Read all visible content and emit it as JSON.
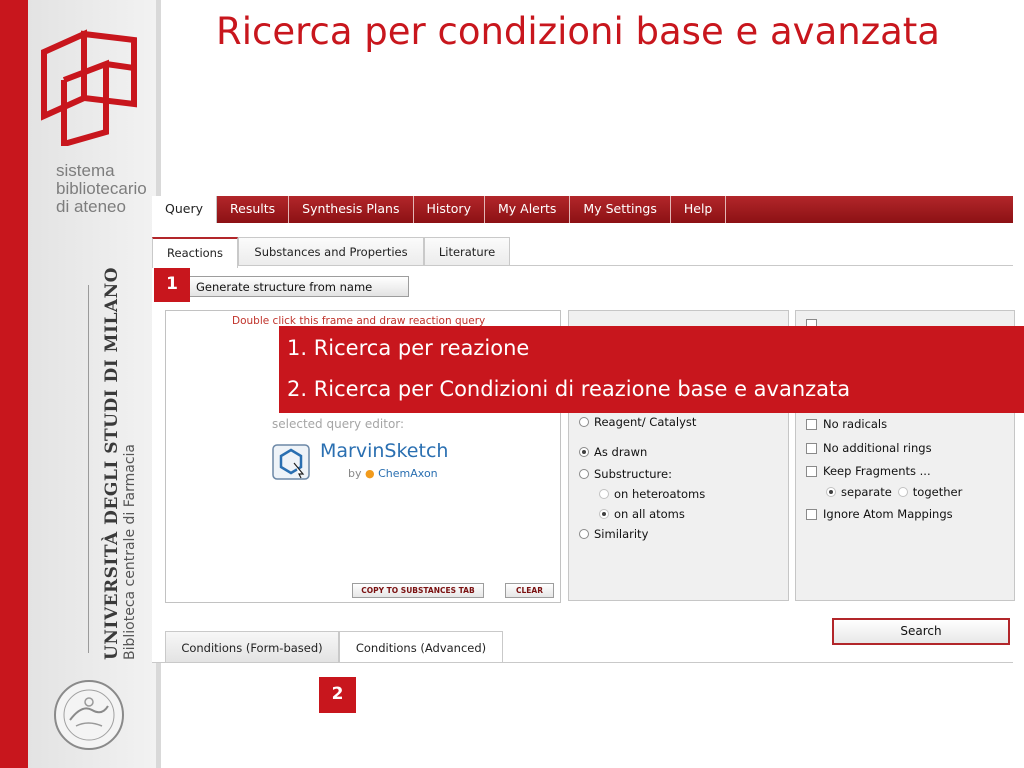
{
  "slide": {
    "title": "Ricerca per condizioni base e avanzata",
    "brand": {
      "sistema_lines": [
        "sistema",
        "bibliotecario",
        "di ateneo"
      ],
      "university": "UNIVERSITÀ DEGLI STUDI DI MILANO",
      "library": "Biblioteca centrale di Farmacia"
    }
  },
  "app": {
    "nav_tabs": [
      {
        "label": "Query",
        "active": true
      },
      {
        "label": "Results"
      },
      {
        "label": "Synthesis Plans"
      },
      {
        "label": "History"
      },
      {
        "label": "My Alerts"
      },
      {
        "label": "My Settings"
      },
      {
        "label": "Help"
      }
    ],
    "sub_tabs": [
      {
        "label": "Reactions",
        "active": true
      },
      {
        "label": "Substances and Properties"
      },
      {
        "label": "Literature"
      }
    ],
    "generate_button": "Generate structure from name",
    "draw_frame": {
      "hint": "Double click this frame and draw reaction query",
      "editor_label": "selected query editor:",
      "editor_name": "MarvinSketch",
      "editor_by": "by",
      "editor_vendor": "ChemAxon",
      "copy_button": "COPY TO SUBSTANCES TAB",
      "clear_button": "CLEAR"
    },
    "options": {
      "reagent": "Reagent/ Catalyst",
      "as_drawn": "As drawn",
      "substructure": "Substructure:",
      "on_heteroatoms": "on heteroatoms",
      "on_all_atoms": "on all atoms",
      "similarity": "Similarity"
    },
    "options_right": {
      "no_radicals": "No radicals",
      "no_additional_rings": "No additional rings",
      "keep_fragments": "Keep Fragments ...",
      "separate": "separate",
      "together": "together",
      "ignore_mappings": "Ignore Atom Mappings"
    },
    "bottom_tabs": [
      {
        "label": "Conditions (Form-based)",
        "active": true
      },
      {
        "label": "Conditions (Advanced)"
      }
    ],
    "search_button": "Search"
  },
  "callouts": {
    "badge_1": "1",
    "badge_2": "2",
    "items": [
      "1. Ricerca per reazione",
      "2. Ricerca per Condizioni di reazione base e avanzata"
    ]
  },
  "colors": {
    "brand_red": "#c8161d",
    "nav_red": "#b2262a",
    "link_blue": "#2a6fb1"
  }
}
